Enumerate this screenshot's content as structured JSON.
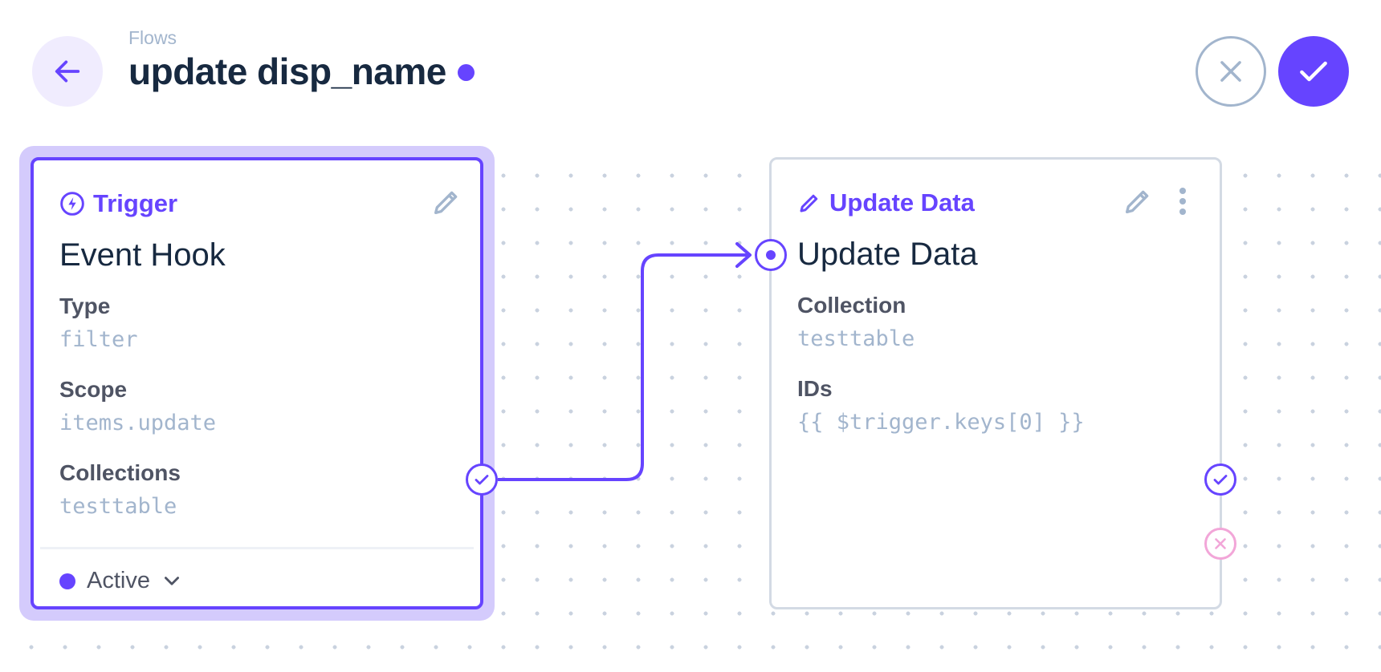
{
  "header": {
    "breadcrumb": "Flows",
    "title": "update disp_name"
  },
  "trigger": {
    "header_label": "Trigger",
    "name": "Event Hook",
    "fields": [
      {
        "label": "Type",
        "value": "filter"
      },
      {
        "label": "Scope",
        "value": "items.update"
      },
      {
        "label": "Collections",
        "value": "testtable"
      }
    ],
    "status": "Active"
  },
  "operation": {
    "header_label": "Update Data",
    "name": "Update Data",
    "fields": [
      {
        "label": "Collection",
        "value": "testtable"
      },
      {
        "label": "IDs",
        "value": "{{ $trigger.keys[0] }}"
      }
    ]
  },
  "colors": {
    "accent": "#6644ff",
    "muted": "#a2b5cd",
    "reject": "#f2a6d8",
    "title": "#172940"
  },
  "icons": {
    "back": "arrow-left-icon",
    "cancel": "close-icon",
    "save": "check-icon",
    "trigger": "bolt-icon",
    "operation": "pencil-icon"
  }
}
